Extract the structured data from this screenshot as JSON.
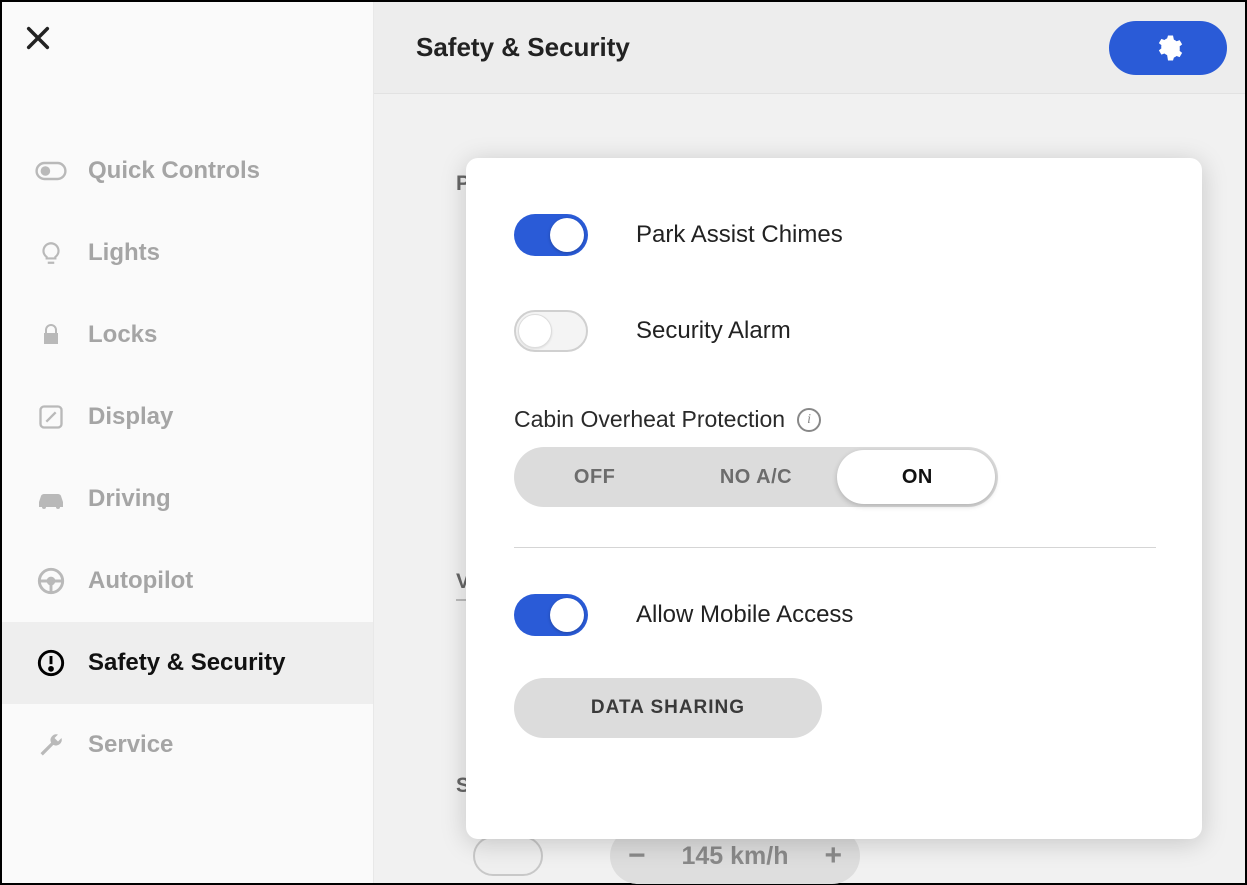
{
  "header": {
    "title": "Safety & Security"
  },
  "sidebar": {
    "items": [
      {
        "label": "Quick Controls",
        "icon": "toggle"
      },
      {
        "label": "Lights",
        "icon": "bulb"
      },
      {
        "label": "Locks",
        "icon": "lock"
      },
      {
        "label": "Display",
        "icon": "display"
      },
      {
        "label": "Driving",
        "icon": "car"
      },
      {
        "label": "Autopilot",
        "icon": "wheel"
      },
      {
        "label": "Safety & Security",
        "icon": "alert",
        "active": true
      },
      {
        "label": "Service",
        "icon": "wrench"
      }
    ]
  },
  "background": {
    "section_p": "P",
    "section_v": "V",
    "section_s": "S",
    "speed_value": "145 km/h"
  },
  "card": {
    "park_assist": {
      "label": "Park Assist Chimes",
      "on": true
    },
    "security_alarm": {
      "label": "Security Alarm",
      "on": false
    },
    "cabin": {
      "label": "Cabin Overheat Protection",
      "options": [
        "OFF",
        "NO A/C",
        "ON"
      ],
      "selected": "ON"
    },
    "mobile_access": {
      "label": "Allow Mobile Access",
      "on": true
    },
    "data_sharing_label": "DATA SHARING"
  }
}
